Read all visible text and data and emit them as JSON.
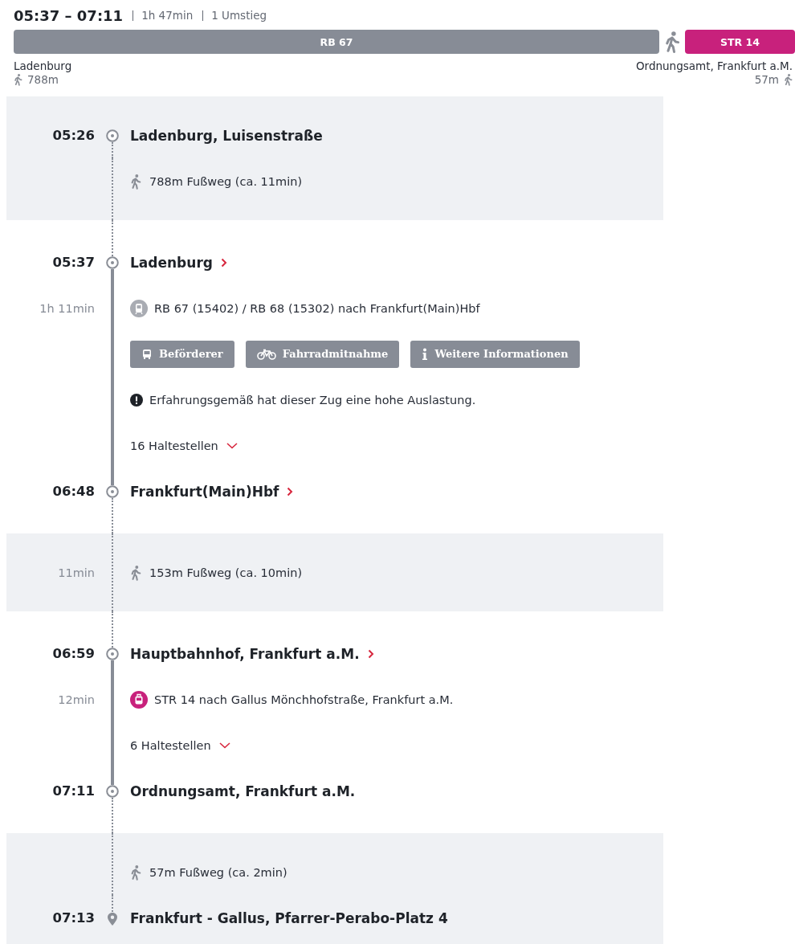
{
  "summary": {
    "time_range": "05:37 – 07:11",
    "duration": "1h 47min",
    "changes": "1 Umstieg"
  },
  "bar": {
    "segments": [
      {
        "kind": "ride",
        "label": "RB 67",
        "color": "#878c96"
      },
      {
        "kind": "walk"
      },
      {
        "kind": "ride",
        "label": "STR 14",
        "color": "#c8217c"
      }
    ]
  },
  "origin": {
    "name": "Ladenburg",
    "walk": "788m"
  },
  "destination": {
    "name": "Ordnungsamt, Frankfurt a.M.",
    "walk": "57m"
  },
  "sections": [
    {
      "kind": "walk",
      "rows": [
        {
          "kind": "stop",
          "time": "05:26",
          "name": "Ladenburg, Luisenstraße",
          "link": false
        },
        {
          "kind": "walk",
          "text": "788m Fußweg (ca. 11min)"
        }
      ]
    },
    {
      "kind": "ride",
      "rows": [
        {
          "kind": "stop",
          "time": "05:37",
          "name": "Ladenburg",
          "link": true
        },
        {
          "kind": "train",
          "duration": "1h 11min",
          "color": "#a9acb3",
          "text": "RB 67 (15402) / RB 68 (15302) nach Frankfurt(Main)Hbf"
        },
        {
          "kind": "buttons",
          "buttons": [
            {
              "kind": "bus",
              "label": "Beförderer"
            },
            {
              "kind": "bike",
              "label": "Fahrradmitnahme"
            },
            {
              "kind": "info",
              "label": "Weitere Informationen"
            }
          ]
        },
        {
          "kind": "notice",
          "text": "Erfahrungsgemäß hat dieser Zug eine hohe Auslastung."
        },
        {
          "kind": "stops",
          "text": "16 Haltestellen",
          "expanded": false
        },
        {
          "kind": "stop",
          "time": "06:48",
          "name": "Frankfurt(Main)Hbf",
          "link": true
        }
      ]
    },
    {
      "kind": "walk",
      "rows": [
        {
          "kind": "walk",
          "duration": "11min",
          "text": "153m Fußweg (ca. 10min)"
        }
      ]
    },
    {
      "kind": "ride",
      "rows": [
        {
          "kind": "stop",
          "time": "06:59",
          "name": "Hauptbahnhof, Frankfurt a.M.",
          "link": true
        },
        {
          "kind": "tram",
          "duration": "12min",
          "color": "#c8217c",
          "text": "STR 14 nach Gallus Mönchhofstraße, Frankfurt a.M."
        },
        {
          "kind": "stops",
          "text": "6 Haltestellen",
          "expanded": false
        },
        {
          "kind": "stop",
          "time": "07:11",
          "name": "Ordnungsamt, Frankfurt a.M.",
          "link": false
        }
      ]
    },
    {
      "kind": "walk",
      "rows": [
        {
          "kind": "walk",
          "text": "57m Fußweg (ca. 2min)"
        },
        {
          "kind": "destination",
          "time": "07:13",
          "name": "Frankfurt - Gallus, Pfarrer-Perabo-Platz 4",
          "link": false
        }
      ]
    }
  ]
}
